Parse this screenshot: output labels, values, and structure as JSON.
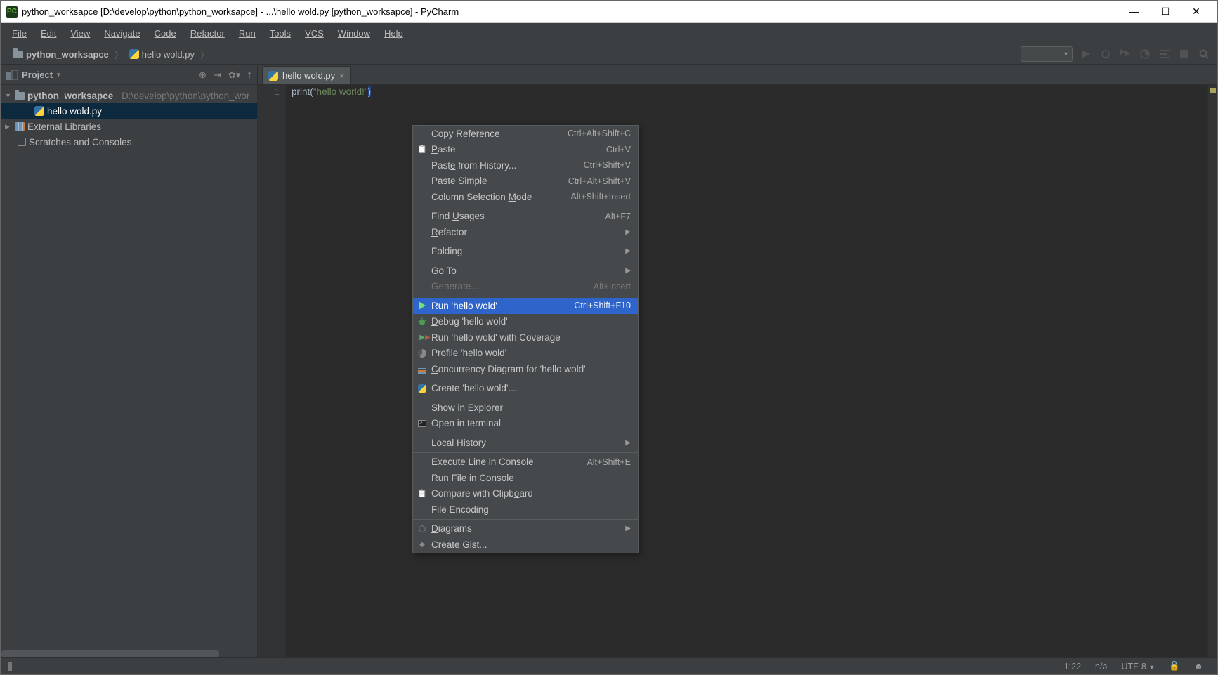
{
  "titlebar": {
    "title": "python_worksapce [D:\\develop\\python\\python_worksapce] - ...\\hello wold.py [python_worksapce] - PyCharm"
  },
  "menubar": [
    "File",
    "Edit",
    "View",
    "Navigate",
    "Code",
    "Refactor",
    "Run",
    "Tools",
    "VCS",
    "Window",
    "Help"
  ],
  "breadcrumbs": {
    "project": "python_worksapce",
    "file": "hello wold.py"
  },
  "sidebar": {
    "title": "Project",
    "root": {
      "name": "python_worksapce",
      "path": "D:\\develop\\python\\python_wor"
    },
    "file": "hello wold.py",
    "external": "External Libraries",
    "scratches": "Scratches and Consoles"
  },
  "editor": {
    "tab": "hello wold.py",
    "line_number": "1",
    "code_fn": "print",
    "code_str": "\"hello world!\""
  },
  "context_menu": {
    "items": [
      {
        "label": "Copy Reference",
        "shortcut": "Ctrl+Alt+Shift+C"
      },
      {
        "label": "Paste",
        "shortcut": "Ctrl+V",
        "icon": "paste",
        "ul": 0
      },
      {
        "label": "Paste from History...",
        "shortcut": "Ctrl+Shift+V",
        "ul": 4
      },
      {
        "label": "Paste Simple",
        "shortcut": "Ctrl+Alt+Shift+V"
      },
      {
        "label": "Column Selection Mode",
        "shortcut": "Alt+Shift+Insert",
        "ul": 17
      },
      {
        "sep": true
      },
      {
        "label": "Find Usages",
        "shortcut": "Alt+F7",
        "ul": 5
      },
      {
        "label": "Refactor",
        "arrow": true,
        "ul": 0
      },
      {
        "sep": true
      },
      {
        "label": "Folding",
        "arrow": true
      },
      {
        "sep": true
      },
      {
        "label": "Go To",
        "arrow": true
      },
      {
        "label": "Generate...",
        "shortcut": "Alt+Insert",
        "disabled": true
      },
      {
        "sep": true
      },
      {
        "label": "Run 'hello wold'",
        "shortcut": "Ctrl+Shift+F10",
        "icon": "play",
        "highlighted": true,
        "ul": 1
      },
      {
        "label": "Debug 'hello wold'",
        "icon": "bug",
        "ul": 0
      },
      {
        "label": "Run 'hello wold' with Coverage",
        "icon": "coverage"
      },
      {
        "label": "Profile 'hello wold'",
        "icon": "profile"
      },
      {
        "label": "Concurrency Diagram for 'hello wold'",
        "icon": "concurrency",
        "ul": 0
      },
      {
        "sep": true
      },
      {
        "label": "Create 'hello wold'...",
        "icon": "python"
      },
      {
        "sep": true
      },
      {
        "label": "Show in Explorer"
      },
      {
        "label": "Open in terminal",
        "icon": "terminal"
      },
      {
        "sep": true
      },
      {
        "label": "Local History",
        "arrow": true,
        "ul": 6
      },
      {
        "sep": true
      },
      {
        "label": "Execute Line in Console",
        "shortcut": "Alt+Shift+E"
      },
      {
        "label": "Run File in Console"
      },
      {
        "label": "Compare with Clipboard",
        "icon": "clip",
        "ul": 18
      },
      {
        "label": "File Encoding"
      },
      {
        "sep": true
      },
      {
        "label": "Diagrams",
        "icon": "diagram",
        "arrow": true,
        "ul": 0
      },
      {
        "label": "Create Gist...",
        "icon": "gist"
      }
    ]
  },
  "statusbar": {
    "pos": "1:22",
    "na": "n/a",
    "encoding": "UTF-8"
  }
}
